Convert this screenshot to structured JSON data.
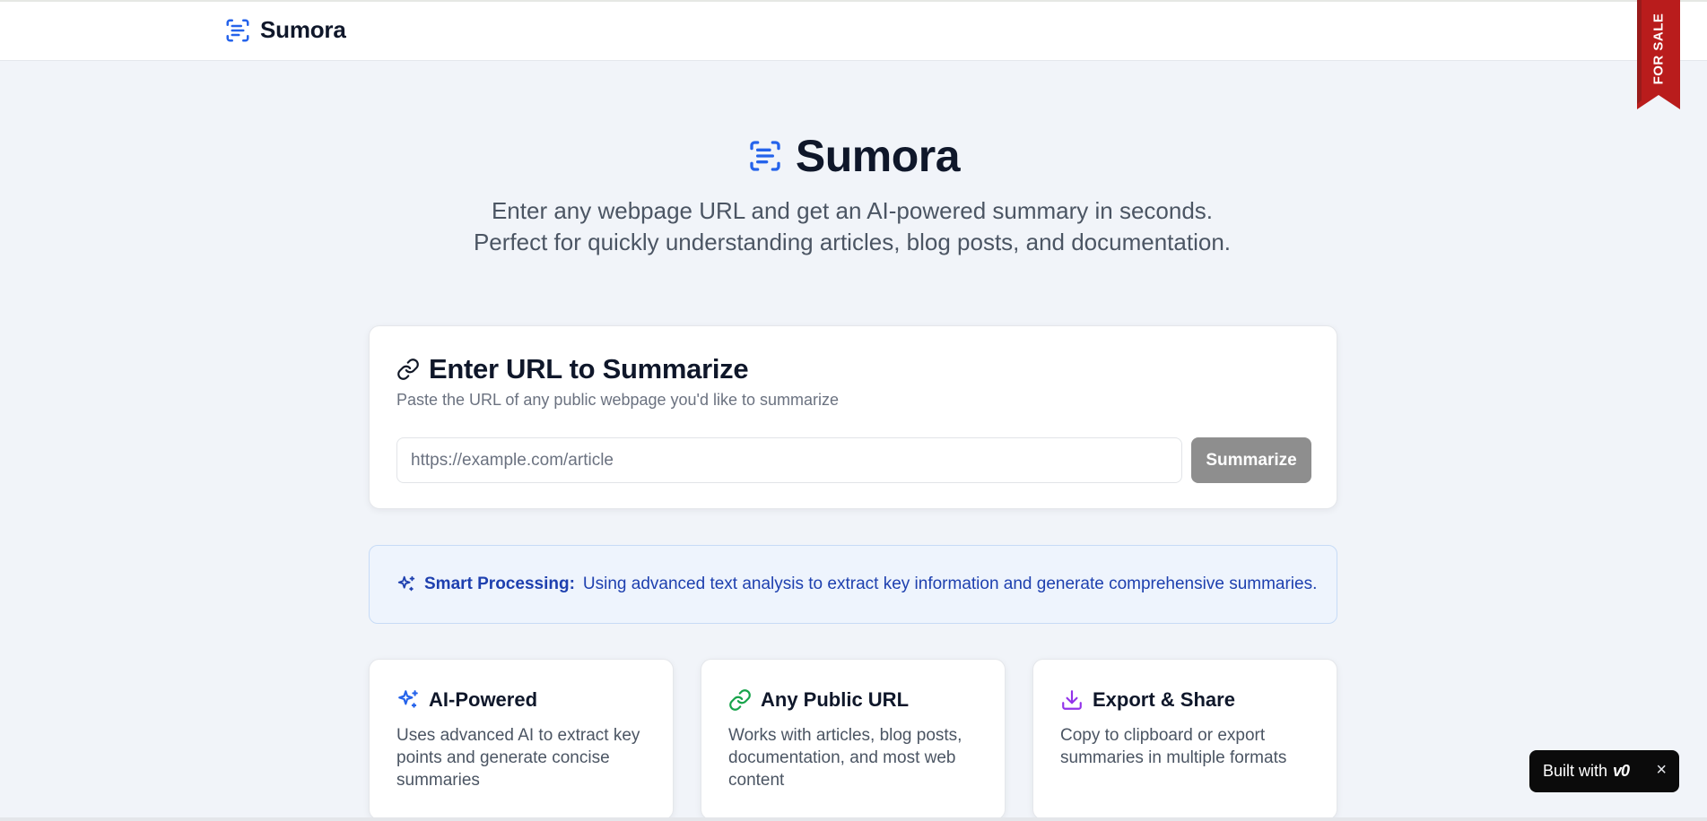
{
  "header": {
    "brand": "Sumora"
  },
  "ribbon": {
    "text": "FOR SALE",
    "color": "#b91c1c"
  },
  "hero": {
    "title": "Sumora",
    "subtitle": "Enter any webpage URL and get an AI-powered summary in seconds. Perfect for quickly understanding articles, blog posts, and documentation."
  },
  "url_card": {
    "title": "Enter URL to Summarize",
    "description": "Paste the URL of any public webpage you'd like to summarize",
    "input_placeholder": "https://example.com/article",
    "input_value": "",
    "button_label": "Summarize"
  },
  "info": {
    "label": "Smart Processing:",
    "text": "Using advanced text analysis to extract key information and generate comprehensive summaries."
  },
  "features": [
    {
      "icon": "sparkles-icon",
      "title": "AI-Powered",
      "text": "Uses advanced AI to extract key points and generate concise summaries",
      "color": "#2563eb"
    },
    {
      "icon": "link-icon",
      "title": "Any Public URL",
      "text": "Works with articles, blog posts, documentation, and most web content",
      "color": "#16a34a"
    },
    {
      "icon": "download-icon",
      "title": "Export & Share",
      "text": "Copy to clipboard or export summaries in multiple formats",
      "color": "#9333ea"
    }
  ],
  "built_with": {
    "text": "Built with",
    "brand": "v0",
    "close": "×"
  },
  "colors": {
    "accent": "#2563eb",
    "button_disabled": "#8e8e8e",
    "info_bg": "#eef4fd",
    "info_text": "#1e40af"
  }
}
